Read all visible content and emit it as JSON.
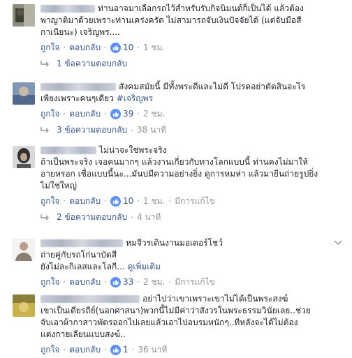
{
  "colors": {
    "link": "#365899",
    "muted": "#90949c",
    "like": "#5890ff"
  },
  "comments": [
    {
      "lines": [
        "ท่านอาจมาเลือกรถไว้สำหรับรับกิจนิมนต์ก็เป็นได้ แล้วต้อง",
        "พาญาติมาด้วยเพราะท่านเคร่งครัด ไม่สามารถจับเงินปัจจัยได้ (แต่จับมือสี",
        "กาเนียนะ) เจริญพร...."
      ],
      "like": "ถูกใจ",
      "reply": "ตอบกลับ",
      "likes": "10",
      "time": "1 ชม.",
      "replies": "1 ข้อความตอบกลับ"
    },
    {
      "lines": [
        "สังคมสมัยนี้ มีทั้งพระดีและไม่ดี โปรดอย่าตัดสินอะไร",
        "เพียงเพราะคนๆเดียว "
      ],
      "hashtag": "#เจริญพร",
      "like": "ถูกใจ",
      "reply": "ตอบกลับ",
      "likes": "39",
      "time": "2 ชม.",
      "replies": "3 ข้อความตอบกลับ",
      "replies_time": "38 นาที"
    },
    {
      "lines": [
        "ไม่น่าจะใช่พระจริง",
        "ถ้าเป็นพระจริง เจอคนมากๆ แล้วงานเกี่ยวกับทางโลกแบบนี้ ท่านคงไม่มาให้",
        "อายหรอก เชื่อแบบนี้นะ...มันบ่มีความอย่างยิ่ง ดูการหมห่า แล้วมายืนถ่ายรูปยิ่ง",
        "ไม่ใช่ใหญ่"
      ],
      "like": "ถูกใจ",
      "reply": "ตอบกลับ",
      "likes": "10",
      "time": "1 ชม.",
      "edited": "มีการแก้ไข",
      "replies": "2 ข้อความตอบกลับ",
      "replies_time": "4 นาที"
    },
    {
      "author_tail": "หมจีวรเดินงานมอเตอร์โชว์",
      "lines": [
        "ถ่ายคู่กับรถโก่นาบัดสี",
        "ยังไม่ละกิเลสและโลกี... "
      ],
      "more": "ดูเพิ่มเติม",
      "like": "ถูกใจ",
      "reply": "ตอบกลับ",
      "likes": "33",
      "time": "2 ชม.",
      "edited": "มีการแก้ไข"
    },
    {
      "lines": [
        "อย่าไปว่าเขาเพราะเขาไม่ได้เป็นพระสงฆ์",
        "เขาเป็นเดียรถีย์(นอกศาสนา)พวกนี้ไม่มีค่าว่าสังวรในพระธรรมวินัยเลย..ช่วย",
        "จับเอาผ้ากาสาวพัตรออกไปเลยแล้วเอาไปอบรมหนักๆ..ทีหลังจะได้ไม่ต้อง",
        "แต่งกายเลียนแบบสงฆ์.."
      ],
      "like": "ถูกใจ",
      "reply": "ตอบกลับ",
      "likes": "1",
      "time": "36 นาที"
    }
  ]
}
